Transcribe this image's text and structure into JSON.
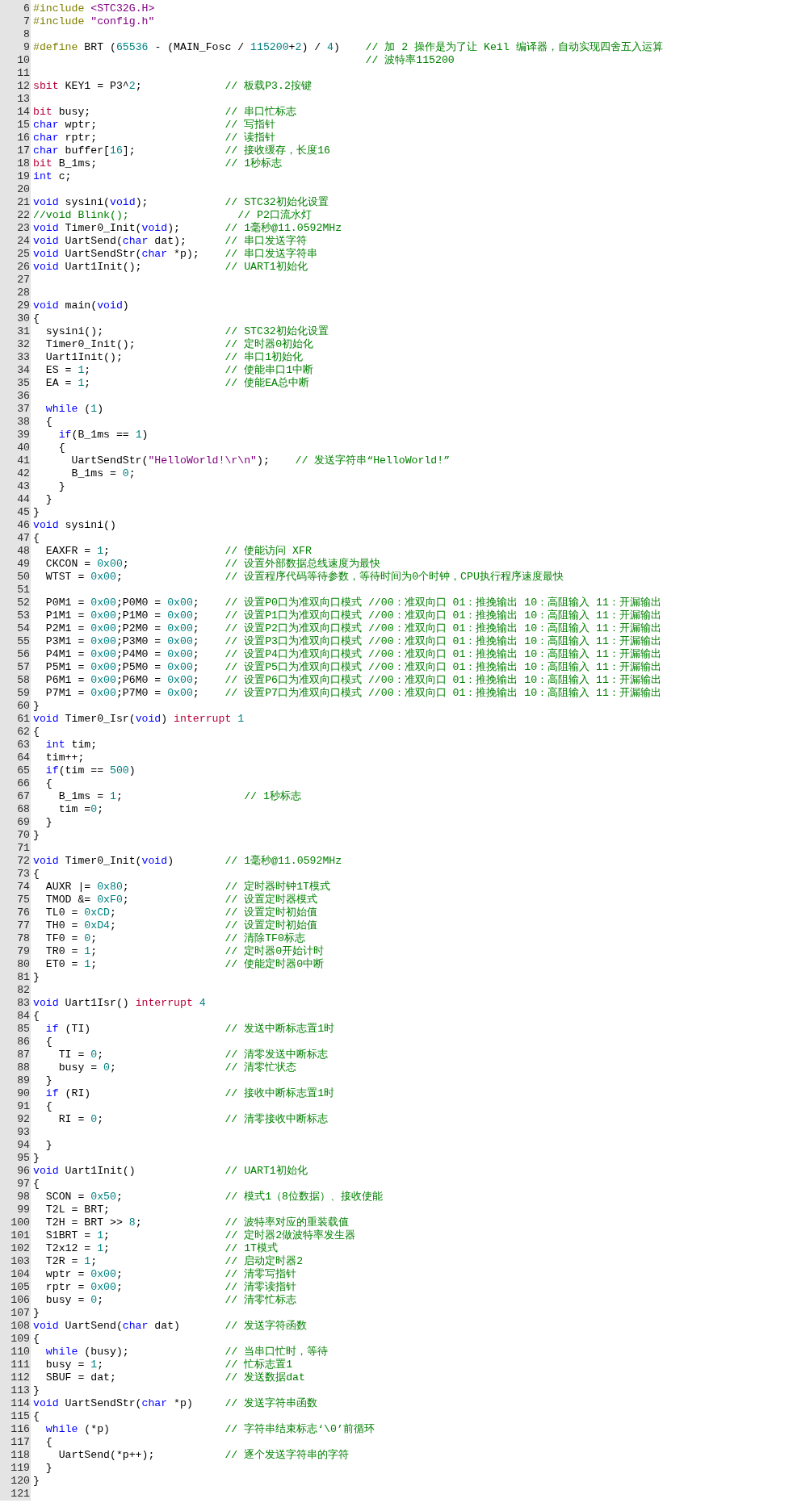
{
  "editor": {
    "lines": [
      {
        "number": "6",
        "segments": [
          {
            "kind": "pre",
            "text": "#include "
          },
          {
            "kind": "str",
            "text": "<STC32G.H>"
          }
        ]
      },
      {
        "number": "7",
        "segments": [
          {
            "kind": "pre",
            "text": "#include "
          },
          {
            "kind": "str",
            "text": "\"config.h\""
          }
        ]
      },
      {
        "number": "8"
      },
      {
        "number": "9",
        "segments": [
          {
            "kind": "pre",
            "text": "#define"
          },
          {
            "kind": "txt",
            "text": " BRT ("
          },
          {
            "kind": "num",
            "text": "65536"
          },
          {
            "kind": "txt",
            "text": " - (MAIN_Fosc / "
          },
          {
            "kind": "num",
            "text": "115200"
          },
          {
            "kind": "txt",
            "text": "+"
          },
          {
            "kind": "num",
            "text": "2"
          },
          {
            "kind": "txt",
            "text": ") / "
          },
          {
            "kind": "num",
            "text": "4"
          },
          {
            "kind": "txt",
            "text": ")    "
          },
          {
            "kind": "com",
            "text": "// 加 2 操作是为了让 Keil 编译器，自动实现四舍五入运算"
          }
        ]
      },
      {
        "number": "10",
        "segments": [
          {
            "kind": "com",
            "text": "                                                    // 波特率115200"
          }
        ]
      },
      {
        "number": "11"
      },
      {
        "number": "12",
        "segments": [
          {
            "kind": "red",
            "text": "sbit"
          },
          {
            "kind": "txt",
            "text": " KEY1 = P3^"
          },
          {
            "kind": "num",
            "text": "2"
          },
          {
            "kind": "txt",
            "text": ";             "
          },
          {
            "kind": "com",
            "text": "// 板载P3.2按键"
          }
        ]
      },
      {
        "number": "13"
      },
      {
        "number": "14",
        "segments": [
          {
            "kind": "red",
            "text": "bit"
          },
          {
            "kind": "txt",
            "text": " busy;                     "
          },
          {
            "kind": "com",
            "text": "// 串口忙标志"
          }
        ]
      },
      {
        "number": "15",
        "segments": [
          {
            "kind": "kw",
            "text": "char"
          },
          {
            "kind": "txt",
            "text": " wptr;                    "
          },
          {
            "kind": "com",
            "text": "// 写指针"
          }
        ]
      },
      {
        "number": "16",
        "segments": [
          {
            "kind": "kw",
            "text": "char"
          },
          {
            "kind": "txt",
            "text": " rptr;                    "
          },
          {
            "kind": "com",
            "text": "// 读指针"
          }
        ]
      },
      {
        "number": "17",
        "segments": [
          {
            "kind": "kw",
            "text": "char"
          },
          {
            "kind": "txt",
            "text": " buffer["
          },
          {
            "kind": "num",
            "text": "16"
          },
          {
            "kind": "txt",
            "text": "];              "
          },
          {
            "kind": "com",
            "text": "// 接收缓存，长度16"
          }
        ]
      },
      {
        "number": "18",
        "segments": [
          {
            "kind": "red",
            "text": "bit"
          },
          {
            "kind": "txt",
            "text": " B_1ms;                    "
          },
          {
            "kind": "com",
            "text": "// 1秒标志"
          }
        ]
      },
      {
        "number": "19",
        "segments": [
          {
            "kind": "kw",
            "text": "int"
          },
          {
            "kind": "txt",
            "text": " c;"
          }
        ]
      },
      {
        "number": "20"
      },
      {
        "number": "21",
        "segments": [
          {
            "kind": "kw",
            "text": "void"
          },
          {
            "kind": "txt",
            "text": " sysini("
          },
          {
            "kind": "kw",
            "text": "void"
          },
          {
            "kind": "txt",
            "text": ");            "
          },
          {
            "kind": "com",
            "text": "// STC32初始化设置"
          }
        ]
      },
      {
        "number": "22",
        "segments": [
          {
            "kind": "com",
            "text": "//void Blink();                 // P2口流水灯"
          }
        ]
      },
      {
        "number": "23",
        "segments": [
          {
            "kind": "kw",
            "text": "void"
          },
          {
            "kind": "txt",
            "text": " Timer0_Init("
          },
          {
            "kind": "kw",
            "text": "void"
          },
          {
            "kind": "txt",
            "text": ");       "
          },
          {
            "kind": "com",
            "text": "// 1毫秒@11.0592MHz"
          }
        ]
      },
      {
        "number": "24",
        "segments": [
          {
            "kind": "kw",
            "text": "void"
          },
          {
            "kind": "txt",
            "text": " UartSend("
          },
          {
            "kind": "kw",
            "text": "char"
          },
          {
            "kind": "txt",
            "text": " dat);      "
          },
          {
            "kind": "com",
            "text": "// 串口发送字符"
          }
        ]
      },
      {
        "number": "25",
        "segments": [
          {
            "kind": "kw",
            "text": "void"
          },
          {
            "kind": "txt",
            "text": " UartSendStr("
          },
          {
            "kind": "kw",
            "text": "char"
          },
          {
            "kind": "txt",
            "text": " *p);    "
          },
          {
            "kind": "com",
            "text": "// 串口发送字符串"
          }
        ]
      },
      {
        "number": "26",
        "segments": [
          {
            "kind": "kw",
            "text": "void"
          },
          {
            "kind": "txt",
            "text": " Uart1Init();             "
          },
          {
            "kind": "com",
            "text": "// UART1初始化"
          }
        ]
      },
      {
        "number": "27"
      },
      {
        "number": "28"
      },
      {
        "number": "29",
        "segments": [
          {
            "kind": "kw",
            "text": "void"
          },
          {
            "kind": "txt",
            "text": " main("
          },
          {
            "kind": "kw",
            "text": "void"
          },
          {
            "kind": "txt",
            "text": ")"
          }
        ]
      },
      {
        "number": "30",
        "segments": [
          {
            "kind": "txt",
            "text": "{"
          }
        ]
      },
      {
        "number": "31",
        "segments": [
          {
            "kind": "txt",
            "text": "  sysini();                   "
          },
          {
            "kind": "com",
            "text": "// STC32初始化设置"
          }
        ]
      },
      {
        "number": "32",
        "segments": [
          {
            "kind": "txt",
            "text": "  Timer0_Init();              "
          },
          {
            "kind": "com",
            "text": "// 定时器0初始化"
          }
        ]
      },
      {
        "number": "33",
        "segments": [
          {
            "kind": "txt",
            "text": "  Uart1Init();                "
          },
          {
            "kind": "com",
            "text": "// 串口1初始化"
          }
        ]
      },
      {
        "number": "34",
        "segments": [
          {
            "kind": "txt",
            "text": "  ES = "
          },
          {
            "kind": "num",
            "text": "1"
          },
          {
            "kind": "txt",
            "text": ";                     "
          },
          {
            "kind": "com",
            "text": "// 使能串口1中断"
          }
        ]
      },
      {
        "number": "35",
        "segments": [
          {
            "kind": "txt",
            "text": "  EA = "
          },
          {
            "kind": "num",
            "text": "1"
          },
          {
            "kind": "txt",
            "text": ";                     "
          },
          {
            "kind": "com",
            "text": "// 使能EA总中断"
          }
        ]
      },
      {
        "number": "36"
      },
      {
        "number": "37",
        "segments": [
          {
            "kind": "kw",
            "text": "  while"
          },
          {
            "kind": "txt",
            "text": " ("
          },
          {
            "kind": "num",
            "text": "1"
          },
          {
            "kind": "txt",
            "text": ")"
          }
        ]
      },
      {
        "number": "38",
        "segments": [
          {
            "kind": "txt",
            "text": "  {"
          }
        ]
      },
      {
        "number": "39",
        "segments": [
          {
            "kind": "kw",
            "text": "    if"
          },
          {
            "kind": "txt",
            "text": "(B_1ms == "
          },
          {
            "kind": "num",
            "text": "1"
          },
          {
            "kind": "txt",
            "text": ")"
          }
        ]
      },
      {
        "number": "40",
        "segments": [
          {
            "kind": "txt",
            "text": "    {"
          }
        ]
      },
      {
        "number": "41",
        "segments": [
          {
            "kind": "txt",
            "text": "      UartSendStr("
          },
          {
            "kind": "str",
            "text": "\"HelloWorld!\\r\\n\""
          },
          {
            "kind": "txt",
            "text": ");    "
          },
          {
            "kind": "com",
            "text": "// 发送字符串“HelloWorld!”"
          }
        ]
      },
      {
        "number": "42",
        "segments": [
          {
            "kind": "txt",
            "text": "      B_1ms = "
          },
          {
            "kind": "num",
            "text": "0"
          },
          {
            "kind": "txt",
            "text": ";"
          }
        ]
      },
      {
        "number": "43",
        "segments": [
          {
            "kind": "txt",
            "text": "    }"
          }
        ]
      },
      {
        "number": "44",
        "segments": [
          {
            "kind": "txt",
            "text": "  }"
          }
        ]
      },
      {
        "number": "45",
        "segments": [
          {
            "kind": "txt",
            "text": "}"
          }
        ]
      },
      {
        "number": "46",
        "segments": [
          {
            "kind": "kw",
            "text": "void"
          },
          {
            "kind": "txt",
            "text": " sysini()"
          }
        ]
      },
      {
        "number": "47",
        "segments": [
          {
            "kind": "txt",
            "text": "{"
          }
        ]
      },
      {
        "number": "48",
        "segments": [
          {
            "kind": "txt",
            "text": "  EAXFR = "
          },
          {
            "kind": "num",
            "text": "1"
          },
          {
            "kind": "txt",
            "text": ";                  "
          },
          {
            "kind": "com",
            "text": "// 使能访问 XFR"
          }
        ]
      },
      {
        "number": "49",
        "segments": [
          {
            "kind": "txt",
            "text": "  CKCON = "
          },
          {
            "kind": "num",
            "text": "0x00"
          },
          {
            "kind": "txt",
            "text": ";               "
          },
          {
            "kind": "com",
            "text": "// 设置外部数据总线速度为最快"
          }
        ]
      },
      {
        "number": "50",
        "segments": [
          {
            "kind": "txt",
            "text": "  WTST = "
          },
          {
            "kind": "num",
            "text": "0x00"
          },
          {
            "kind": "txt",
            "text": ";                "
          },
          {
            "kind": "com",
            "text": "// 设置程序代码等待参数，等待时间为0个时钟，CPU执行程序速度最快"
          }
        ]
      },
      {
        "number": "51"
      },
      {
        "number": "52",
        "segments": [
          {
            "kind": "txt",
            "text": "  P0M1 = "
          },
          {
            "kind": "num",
            "text": "0x00"
          },
          {
            "kind": "txt",
            "text": ";P0M0 = "
          },
          {
            "kind": "num",
            "text": "0x00"
          },
          {
            "kind": "txt",
            "text": ";    "
          },
          {
            "kind": "com",
            "text": "// 设置P0口为准双向口模式 //00：准双向口 01：推挽输出 10：高阻输入 11：开漏输出"
          }
        ]
      },
      {
        "number": "53",
        "segments": [
          {
            "kind": "txt",
            "text": "  P1M1 = "
          },
          {
            "kind": "num",
            "text": "0x00"
          },
          {
            "kind": "txt",
            "text": ";P1M0 = "
          },
          {
            "kind": "num",
            "text": "0x00"
          },
          {
            "kind": "txt",
            "text": ";    "
          },
          {
            "kind": "com",
            "text": "// 设置P1口为准双向口模式 //00：准双向口 01：推挽输出 10：高阻输入 11：开漏输出"
          }
        ]
      },
      {
        "number": "54",
        "segments": [
          {
            "kind": "txt",
            "text": "  P2M1 = "
          },
          {
            "kind": "num",
            "text": "0x00"
          },
          {
            "kind": "txt",
            "text": ";P2M0 = "
          },
          {
            "kind": "num",
            "text": "0x00"
          },
          {
            "kind": "txt",
            "text": ";    "
          },
          {
            "kind": "com",
            "text": "// 设置P2口为准双向口模式 //00：准双向口 01：推挽输出 10：高阻输入 11：开漏输出"
          }
        ]
      },
      {
        "number": "55",
        "segments": [
          {
            "kind": "txt",
            "text": "  P3M1 = "
          },
          {
            "kind": "num",
            "text": "0x00"
          },
          {
            "kind": "txt",
            "text": ";P3M0 = "
          },
          {
            "kind": "num",
            "text": "0x00"
          },
          {
            "kind": "txt",
            "text": ";    "
          },
          {
            "kind": "com",
            "text": "// 设置P3口为准双向口模式 //00：准双向口 01：推挽输出 10：高阻输入 11：开漏输出"
          }
        ]
      },
      {
        "number": "56",
        "segments": [
          {
            "kind": "txt",
            "text": "  P4M1 = "
          },
          {
            "kind": "num",
            "text": "0x00"
          },
          {
            "kind": "txt",
            "text": ";P4M0 = "
          },
          {
            "kind": "num",
            "text": "0x00"
          },
          {
            "kind": "txt",
            "text": ";    "
          },
          {
            "kind": "com",
            "text": "// 设置P4口为准双向口模式 //00：准双向口 01：推挽输出 10：高阻输入 11：开漏输出"
          }
        ]
      },
      {
        "number": "57",
        "segments": [
          {
            "kind": "txt",
            "text": "  P5M1 = "
          },
          {
            "kind": "num",
            "text": "0x00"
          },
          {
            "kind": "txt",
            "text": ";P5M0 = "
          },
          {
            "kind": "num",
            "text": "0x00"
          },
          {
            "kind": "txt",
            "text": ";    "
          },
          {
            "kind": "com",
            "text": "// 设置P5口为准双向口模式 //00：准双向口 01：推挽输出 10：高阻输入 11：开漏输出"
          }
        ]
      },
      {
        "number": "58",
        "segments": [
          {
            "kind": "txt",
            "text": "  P6M1 = "
          },
          {
            "kind": "num",
            "text": "0x00"
          },
          {
            "kind": "txt",
            "text": ";P6M0 = "
          },
          {
            "kind": "num",
            "text": "0x00"
          },
          {
            "kind": "txt",
            "text": ";    "
          },
          {
            "kind": "com",
            "text": "// 设置P6口为准双向口模式 //00：准双向口 01：推挽输出 10：高阻输入 11：开漏输出"
          }
        ]
      },
      {
        "number": "59",
        "segments": [
          {
            "kind": "txt",
            "text": "  P7M1 = "
          },
          {
            "kind": "num",
            "text": "0x00"
          },
          {
            "kind": "txt",
            "text": ";P7M0 = "
          },
          {
            "kind": "num",
            "text": "0x00"
          },
          {
            "kind": "txt",
            "text": ";    "
          },
          {
            "kind": "com",
            "text": "// 设置P7口为准双向口模式 //00：准双向口 01：推挽输出 10：高阻输入 11：开漏输出"
          }
        ]
      },
      {
        "number": "60",
        "segments": [
          {
            "kind": "txt",
            "text": "}"
          }
        ]
      },
      {
        "number": "61",
        "segments": [
          {
            "kind": "kw",
            "text": "void"
          },
          {
            "kind": "txt",
            "text": " Timer0_Isr("
          },
          {
            "kind": "kw",
            "text": "void"
          },
          {
            "kind": "txt",
            "text": ") "
          },
          {
            "kind": "red",
            "text": "interrupt"
          },
          {
            "kind": "num",
            "text": " 1"
          }
        ]
      },
      {
        "number": "62",
        "segments": [
          {
            "kind": "txt",
            "text": "{"
          }
        ]
      },
      {
        "number": "63",
        "segments": [
          {
            "kind": "kw",
            "text": "  int"
          },
          {
            "kind": "txt",
            "text": " tim;"
          }
        ]
      },
      {
        "number": "64",
        "segments": [
          {
            "kind": "txt",
            "text": "  tim++;"
          }
        ]
      },
      {
        "number": "65",
        "segments": [
          {
            "kind": "kw",
            "text": "  if"
          },
          {
            "kind": "txt",
            "text": "(tim == "
          },
          {
            "kind": "num",
            "text": "500"
          },
          {
            "kind": "txt",
            "text": ")"
          }
        ]
      },
      {
        "number": "66",
        "segments": [
          {
            "kind": "txt",
            "text": "  {"
          }
        ]
      },
      {
        "number": "67",
        "segments": [
          {
            "kind": "txt",
            "text": "    B_1ms = "
          },
          {
            "kind": "num",
            "text": "1"
          },
          {
            "kind": "txt",
            "text": ";                   "
          },
          {
            "kind": "com",
            "text": "// 1秒标志"
          }
        ]
      },
      {
        "number": "68",
        "segments": [
          {
            "kind": "txt",
            "text": "    tim ="
          },
          {
            "kind": "num",
            "text": "0"
          },
          {
            "kind": "txt",
            "text": ";"
          }
        ]
      },
      {
        "number": "69",
        "segments": [
          {
            "kind": "txt",
            "text": "  }"
          }
        ]
      },
      {
        "number": "70",
        "segments": [
          {
            "kind": "txt",
            "text": "}"
          }
        ]
      },
      {
        "number": "71"
      },
      {
        "number": "72",
        "segments": [
          {
            "kind": "kw",
            "text": "void"
          },
          {
            "kind": "txt",
            "text": " Timer0_Init("
          },
          {
            "kind": "kw",
            "text": "void"
          },
          {
            "kind": "txt",
            "text": ")        "
          },
          {
            "kind": "com",
            "text": "// 1毫秒@11.0592MHz"
          }
        ]
      },
      {
        "number": "73",
        "segments": [
          {
            "kind": "txt",
            "text": "{"
          }
        ]
      },
      {
        "number": "74",
        "segments": [
          {
            "kind": "txt",
            "text": "  AUXR |= "
          },
          {
            "kind": "num",
            "text": "0x80"
          },
          {
            "kind": "txt",
            "text": ";               "
          },
          {
            "kind": "com",
            "text": "// 定时器时钟1T模式"
          }
        ]
      },
      {
        "number": "75",
        "segments": [
          {
            "kind": "txt",
            "text": "  TMOD &= "
          },
          {
            "kind": "num",
            "text": "0xF0"
          },
          {
            "kind": "txt",
            "text": ";               "
          },
          {
            "kind": "com",
            "text": "// 设置定时器模式"
          }
        ]
      },
      {
        "number": "76",
        "segments": [
          {
            "kind": "txt",
            "text": "  TL0 = "
          },
          {
            "kind": "num",
            "text": "0xCD"
          },
          {
            "kind": "txt",
            "text": ";                 "
          },
          {
            "kind": "com",
            "text": "// 设置定时初始值"
          }
        ]
      },
      {
        "number": "77",
        "segments": [
          {
            "kind": "txt",
            "text": "  TH0 = "
          },
          {
            "kind": "num",
            "text": "0xD4"
          },
          {
            "kind": "txt",
            "text": ";                 "
          },
          {
            "kind": "com",
            "text": "// 设置定时初始值"
          }
        ]
      },
      {
        "number": "78",
        "segments": [
          {
            "kind": "txt",
            "text": "  TF0 = "
          },
          {
            "kind": "num",
            "text": "0"
          },
          {
            "kind": "txt",
            "text": ";                    "
          },
          {
            "kind": "com",
            "text": "// 清除TF0标志"
          }
        ]
      },
      {
        "number": "79",
        "segments": [
          {
            "kind": "txt",
            "text": "  TR0 = "
          },
          {
            "kind": "num",
            "text": "1"
          },
          {
            "kind": "txt",
            "text": ";                    "
          },
          {
            "kind": "com",
            "text": "// 定时器0开始计时"
          }
        ]
      },
      {
        "number": "80",
        "segments": [
          {
            "kind": "txt",
            "text": "  ET0 = "
          },
          {
            "kind": "num",
            "text": "1"
          },
          {
            "kind": "txt",
            "text": ";                    "
          },
          {
            "kind": "com",
            "text": "// 使能定时器0中断"
          }
        ]
      },
      {
        "number": "81",
        "segments": [
          {
            "kind": "txt",
            "text": "}"
          }
        ]
      },
      {
        "number": "82"
      },
      {
        "number": "83",
        "segments": [
          {
            "kind": "kw",
            "text": "void"
          },
          {
            "kind": "txt",
            "text": " Uart1Isr() "
          },
          {
            "kind": "red",
            "text": "interrupt"
          },
          {
            "kind": "num",
            "text": " 4"
          }
        ]
      },
      {
        "number": "84",
        "segments": [
          {
            "kind": "txt",
            "text": "{"
          }
        ]
      },
      {
        "number": "85",
        "segments": [
          {
            "kind": "kw",
            "text": "  if"
          },
          {
            "kind": "txt",
            "text": " (TI)                     "
          },
          {
            "kind": "com",
            "text": "// 发送中断标志置1时"
          }
        ]
      },
      {
        "number": "86",
        "segments": [
          {
            "kind": "txt",
            "text": "  {"
          }
        ]
      },
      {
        "number": "87",
        "segments": [
          {
            "kind": "txt",
            "text": "    TI = "
          },
          {
            "kind": "num",
            "text": "0"
          },
          {
            "kind": "txt",
            "text": ";                   "
          },
          {
            "kind": "com",
            "text": "// 清零发送中断标志"
          }
        ]
      },
      {
        "number": "88",
        "segments": [
          {
            "kind": "txt",
            "text": "    busy = "
          },
          {
            "kind": "num",
            "text": "0"
          },
          {
            "kind": "txt",
            "text": ";                 "
          },
          {
            "kind": "com",
            "text": "// 清零忙状态"
          }
        ]
      },
      {
        "number": "89",
        "segments": [
          {
            "kind": "txt",
            "text": "  }"
          }
        ]
      },
      {
        "number": "90",
        "segments": [
          {
            "kind": "kw",
            "text": "  if"
          },
          {
            "kind": "txt",
            "text": " (RI)                     "
          },
          {
            "kind": "com",
            "text": "// 接收中断标志置1时"
          }
        ]
      },
      {
        "number": "91",
        "segments": [
          {
            "kind": "txt",
            "text": "  {"
          }
        ]
      },
      {
        "number": "92",
        "segments": [
          {
            "kind": "txt",
            "text": "    RI = "
          },
          {
            "kind": "num",
            "text": "0"
          },
          {
            "kind": "txt",
            "text": ";                   "
          },
          {
            "kind": "com",
            "text": "// 清零接收中断标志"
          }
        ]
      },
      {
        "number": "93"
      },
      {
        "number": "94",
        "segments": [
          {
            "kind": "txt",
            "text": "  }"
          }
        ]
      },
      {
        "number": "95",
        "segments": [
          {
            "kind": "txt",
            "text": "}"
          }
        ]
      },
      {
        "number": "96",
        "segments": [
          {
            "kind": "kw",
            "text": "void"
          },
          {
            "kind": "txt",
            "text": " Uart1Init()              "
          },
          {
            "kind": "com",
            "text": "// UART1初始化"
          }
        ]
      },
      {
        "number": "97",
        "segments": [
          {
            "kind": "txt",
            "text": "{"
          }
        ]
      },
      {
        "number": "98",
        "segments": [
          {
            "kind": "txt",
            "text": "  SCON = "
          },
          {
            "kind": "num",
            "text": "0x50"
          },
          {
            "kind": "txt",
            "text": ";                "
          },
          {
            "kind": "com",
            "text": "// 模式1（8位数据）、接收使能"
          }
        ]
      },
      {
        "number": "99",
        "segments": [
          {
            "kind": "txt",
            "text": "  T2L = BRT;"
          }
        ]
      },
      {
        "number": "100",
        "segments": [
          {
            "kind": "txt",
            "text": "  T2H = BRT >> "
          },
          {
            "kind": "num",
            "text": "8"
          },
          {
            "kind": "txt",
            "text": ";             "
          },
          {
            "kind": "com",
            "text": "// 波特率对应的重装载值"
          }
        ]
      },
      {
        "number": "101",
        "segments": [
          {
            "kind": "txt",
            "text": "  S1BRT = "
          },
          {
            "kind": "num",
            "text": "1"
          },
          {
            "kind": "txt",
            "text": ";                  "
          },
          {
            "kind": "com",
            "text": "// 定时器2做波特率发生器"
          }
        ]
      },
      {
        "number": "102",
        "segments": [
          {
            "kind": "txt",
            "text": "  T2x12 = "
          },
          {
            "kind": "num",
            "text": "1"
          },
          {
            "kind": "txt",
            "text": ";                  "
          },
          {
            "kind": "com",
            "text": "// 1T模式"
          }
        ]
      },
      {
        "number": "103",
        "segments": [
          {
            "kind": "txt",
            "text": "  T2R = "
          },
          {
            "kind": "num",
            "text": "1"
          },
          {
            "kind": "txt",
            "text": ";                    "
          },
          {
            "kind": "com",
            "text": "// 启动定时器2"
          }
        ]
      },
      {
        "number": "104",
        "segments": [
          {
            "kind": "txt",
            "text": "  wptr = "
          },
          {
            "kind": "num",
            "text": "0x00"
          },
          {
            "kind": "txt",
            "text": ";                "
          },
          {
            "kind": "com",
            "text": "// 清零写指针"
          }
        ]
      },
      {
        "number": "105",
        "segments": [
          {
            "kind": "txt",
            "text": "  rptr = "
          },
          {
            "kind": "num",
            "text": "0x00"
          },
          {
            "kind": "txt",
            "text": ";                "
          },
          {
            "kind": "com",
            "text": "// 清零读指针"
          }
        ]
      },
      {
        "number": "106",
        "segments": [
          {
            "kind": "txt",
            "text": "  busy = "
          },
          {
            "kind": "num",
            "text": "0"
          },
          {
            "kind": "txt",
            "text": ";                   "
          },
          {
            "kind": "com",
            "text": "// 清零忙标志"
          }
        ]
      },
      {
        "number": "107",
        "segments": [
          {
            "kind": "txt",
            "text": "}"
          }
        ]
      },
      {
        "number": "108",
        "segments": [
          {
            "kind": "kw",
            "text": "void"
          },
          {
            "kind": "txt",
            "text": " UartSend("
          },
          {
            "kind": "kw",
            "text": "char"
          },
          {
            "kind": "txt",
            "text": " dat)       "
          },
          {
            "kind": "com",
            "text": "// 发送字符函数"
          }
        ]
      },
      {
        "number": "109",
        "segments": [
          {
            "kind": "txt",
            "text": "{"
          }
        ]
      },
      {
        "number": "110",
        "segments": [
          {
            "kind": "kw",
            "text": "  while"
          },
          {
            "kind": "txt",
            "text": " (busy);               "
          },
          {
            "kind": "com",
            "text": "// 当串口忙时，等待"
          }
        ]
      },
      {
        "number": "111",
        "segments": [
          {
            "kind": "txt",
            "text": "  busy = "
          },
          {
            "kind": "num",
            "text": "1"
          },
          {
            "kind": "txt",
            "text": ";                   "
          },
          {
            "kind": "com",
            "text": "// 忙标志置1"
          }
        ]
      },
      {
        "number": "112",
        "segments": [
          {
            "kind": "txt",
            "text": "  SBUF = dat;                 "
          },
          {
            "kind": "com",
            "text": "// 发送数据dat"
          }
        ]
      },
      {
        "number": "113",
        "segments": [
          {
            "kind": "txt",
            "text": "}"
          }
        ]
      },
      {
        "number": "114",
        "segments": [
          {
            "kind": "kw",
            "text": "void"
          },
          {
            "kind": "txt",
            "text": " UartSendStr("
          },
          {
            "kind": "kw",
            "text": "char"
          },
          {
            "kind": "txt",
            "text": " *p)     "
          },
          {
            "kind": "com",
            "text": "// 发送字符串函数"
          }
        ]
      },
      {
        "number": "115",
        "segments": [
          {
            "kind": "txt",
            "text": "{"
          }
        ]
      },
      {
        "number": "116",
        "segments": [
          {
            "kind": "kw",
            "text": "  while"
          },
          {
            "kind": "txt",
            "text": " (*p)                  "
          },
          {
            "kind": "com",
            "text": "// 字符串结束标志‘\\0’前循环"
          }
        ]
      },
      {
        "number": "117",
        "segments": [
          {
            "kind": "txt",
            "text": "  {"
          }
        ]
      },
      {
        "number": "118",
        "segments": [
          {
            "kind": "txt",
            "text": "    UartSend(*p++);           "
          },
          {
            "kind": "com",
            "text": "// 逐个发送字符串的字符"
          }
        ]
      },
      {
        "number": "119",
        "segments": [
          {
            "kind": "txt",
            "text": "  }"
          }
        ]
      },
      {
        "number": "120",
        "segments": [
          {
            "kind": "txt",
            "text": "}"
          }
        ]
      },
      {
        "number": "121"
      }
    ]
  }
}
